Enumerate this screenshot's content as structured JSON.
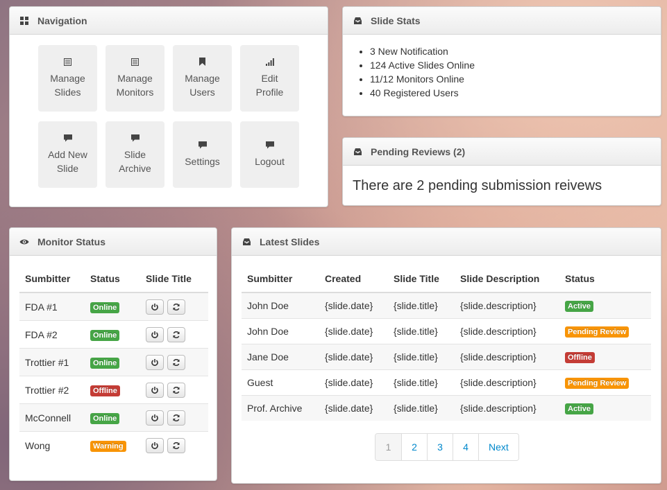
{
  "colors": {
    "online": "#46a546",
    "offline": "#c43c35",
    "warning": "#f89406",
    "active": "#46a546",
    "pending": "#f89406",
    "link": "#0088cc"
  },
  "navigation": {
    "title": "Navigation",
    "icon": "dashboard-grid-icon",
    "tiles": [
      {
        "label": "Manage\nSlides",
        "icon": "list-icon"
      },
      {
        "label": "Manage\nMonitors",
        "icon": "list-icon"
      },
      {
        "label": "Manage\nUsers",
        "icon": "bookmark-icon"
      },
      {
        "label": "Edit\nProfile",
        "icon": "signal-icon"
      },
      {
        "label": "Add New\nSlide",
        "icon": "comment-icon"
      },
      {
        "label": "Slide\nArchive",
        "icon": "comment-icon"
      },
      {
        "label": "Settings",
        "icon": "comment-icon"
      },
      {
        "label": "Logout",
        "icon": "comment-icon"
      }
    ]
  },
  "stats": {
    "title": "Slide Stats",
    "icon": "inbox-icon",
    "items": [
      "3 New Notification",
      "124 Active Slides Online",
      "11/12 Monitors Online",
      "40 Registered Users"
    ]
  },
  "reviews": {
    "title": "Pending Reviews (2)",
    "icon": "inbox-icon",
    "text": "There are 2 pending submission reivews"
  },
  "monitor": {
    "title": "Monitor Status",
    "icon": "eye-icon",
    "columns": [
      "Sumbitter",
      "Status",
      "Slide Title"
    ],
    "rows": [
      {
        "name": "FDA #1",
        "status": "Online",
        "kind": "online"
      },
      {
        "name": "FDA #2",
        "status": "Online",
        "kind": "online"
      },
      {
        "name": "Trottier #1",
        "status": "Online",
        "kind": "online"
      },
      {
        "name": "Trottier #2",
        "status": "Offline",
        "kind": "offline"
      },
      {
        "name": "McConnell",
        "status": "Online",
        "kind": "online"
      },
      {
        "name": "Wong",
        "status": "Warning",
        "kind": "warning"
      }
    ]
  },
  "latest": {
    "title": "Latest Slides",
    "icon": "inbox-icon",
    "columns": [
      "Sumbitter",
      "Created",
      "Slide Title",
      "Slide Description",
      "Status"
    ],
    "rows": [
      {
        "submitter": "John Doe",
        "created": "{slide.date}",
        "title": "{slide.title}",
        "description": "{slide.description}",
        "status": "Active",
        "kind": "active"
      },
      {
        "submitter": "John Doe",
        "created": "{slide.date}",
        "title": "{slide.title}",
        "description": "{slide.description}",
        "status": "Pending Review",
        "kind": "pending"
      },
      {
        "submitter": "Jane Doe",
        "created": "{slide.date}",
        "title": "{slide.title}",
        "description": "{slide.description}",
        "status": "Offline",
        "kind": "offline"
      },
      {
        "submitter": "Guest",
        "created": "{slide.date}",
        "title": "{slide.title}",
        "description": "{slide.description}",
        "status": "Pending Review",
        "kind": "pending"
      },
      {
        "submitter": "Prof. Archive",
        "created": "{slide.date}",
        "title": "{slide.title}",
        "description": "{slide.description}",
        "status": "Active",
        "kind": "active"
      }
    ],
    "pagination": {
      "pages": [
        "1",
        "2",
        "3",
        "4"
      ],
      "next": "Next",
      "current": "1"
    }
  }
}
